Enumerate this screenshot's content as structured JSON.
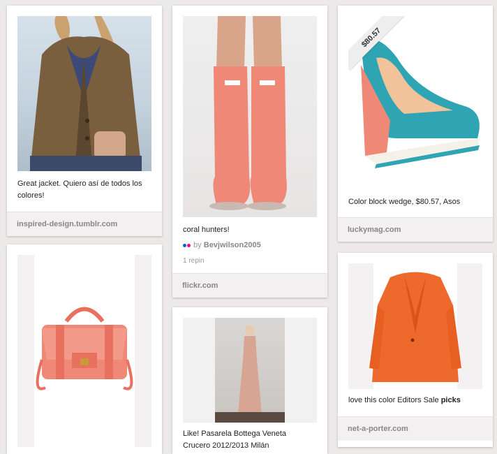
{
  "pins": [
    {
      "id": "jacket",
      "description": "Great jacket. Quiero así de todos los colores!",
      "source": "inspired-design.tumblr.com",
      "image": "brown tweed jacket"
    },
    {
      "id": "boots",
      "description": "coral hunters!",
      "attribution_prefix": "by",
      "attribution_user": "Bevjwilson2005",
      "repins": "1 repin",
      "source": "flickr.com",
      "image": "coral rain boots"
    },
    {
      "id": "wedge",
      "price_tag": "$80.57",
      "description": "Color block wedge, $80.57, Asos",
      "source": "luckymag.com",
      "image": "color block wedge shoe"
    },
    {
      "id": "bag",
      "image": "coral satchel bag"
    },
    {
      "id": "dress",
      "description": "Like! Pasarela Bottega Veneta Crucero 2012/2013 Milán",
      "image": "blush gown runway"
    },
    {
      "id": "blazer",
      "description_main": "love this color Editors Sale",
      "description_bold": "picks",
      "source": "net-a-porter.com",
      "image": "orange blazer"
    }
  ],
  "colors": {
    "background": "#ece9e9",
    "coral": "#f08878",
    "flickr_blue": "#0063dc",
    "flickr_pink": "#ff0084"
  }
}
